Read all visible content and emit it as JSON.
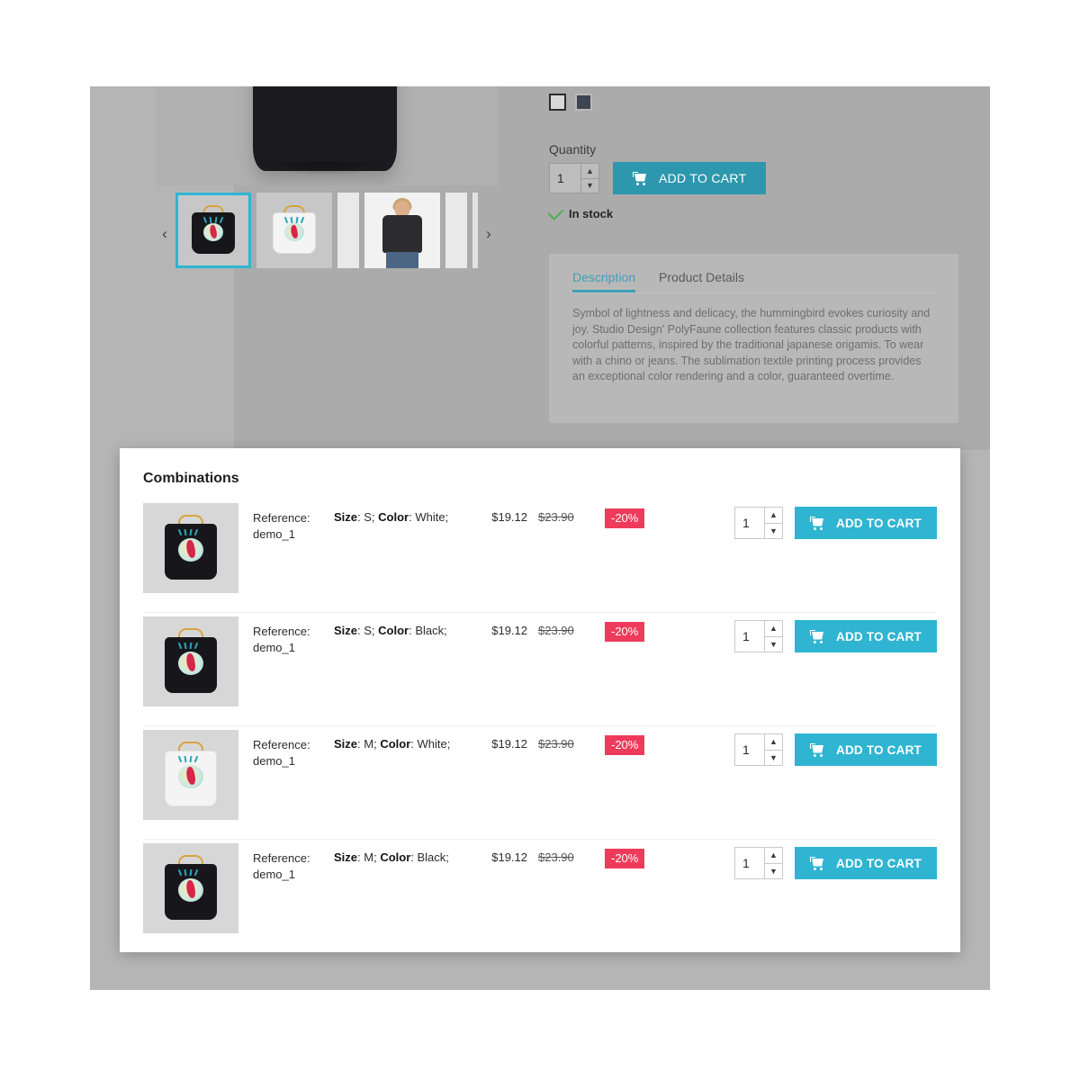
{
  "gallery": {
    "prev_label": "‹",
    "next_label": "›",
    "thumbs": [
      {
        "name": "black-tshirt-front",
        "selected": true
      },
      {
        "name": "white-tshirt-front",
        "selected": false
      },
      {
        "name": "model-wearing-coat",
        "selected": false
      },
      {
        "name": "black-coat-flatlay",
        "selected": false
      }
    ]
  },
  "product": {
    "colors": [
      {
        "name": "White",
        "hex": "#d8d8d8"
      },
      {
        "name": "Black",
        "hex": "#3d4550"
      }
    ],
    "quantity_label": "Quantity",
    "quantity_value": "1",
    "add_to_cart_label": "ADD TO CART",
    "stock_label": "In stock"
  },
  "tabs": {
    "items": [
      {
        "label": "Description",
        "active": true
      },
      {
        "label": "Product Details",
        "active": false
      }
    ],
    "description": "Symbol of lightness and delicacy, the hummingbird evokes curiosity and joy. Studio Design' PolyFaune collection features classic products with colorful patterns, inspired by the traditional japanese origamis. To wear with a chino or jeans. The sublimation textile printing process provides an exceptional color rendering and a color, guaranteed overtime."
  },
  "combinations": {
    "title": "Combinations",
    "reference_label": "Reference:",
    "size_label": "Size",
    "color_label": "Color",
    "add_to_cart_label": "ADD TO CART",
    "rows": [
      {
        "reference": "demo_1",
        "size": "S",
        "color": "White",
        "price": "$19.12",
        "old_price": "$23.90",
        "discount": "-20%",
        "quantity": "1",
        "thumb_variant": "black"
      },
      {
        "reference": "demo_1",
        "size": "S",
        "color": "Black",
        "price": "$19.12",
        "old_price": "$23.90",
        "discount": "-20%",
        "quantity": "1",
        "thumb_variant": "black"
      },
      {
        "reference": "demo_1",
        "size": "M",
        "color": "White",
        "price": "$19.12",
        "old_price": "$23.90",
        "discount": "-20%",
        "quantity": "1",
        "thumb_variant": "white"
      },
      {
        "reference": "demo_1",
        "size": "M",
        "color": "Black",
        "price": "$19.12",
        "old_price": "$23.90",
        "discount": "-20%",
        "quantity": "1",
        "thumb_variant": "black"
      }
    ]
  },
  "colors": {
    "accent_cyan": "#2fb5d2",
    "accent_teal": "#2d97ae",
    "badge_red": "#ef3b5b",
    "stock_green": "#4caf50"
  }
}
